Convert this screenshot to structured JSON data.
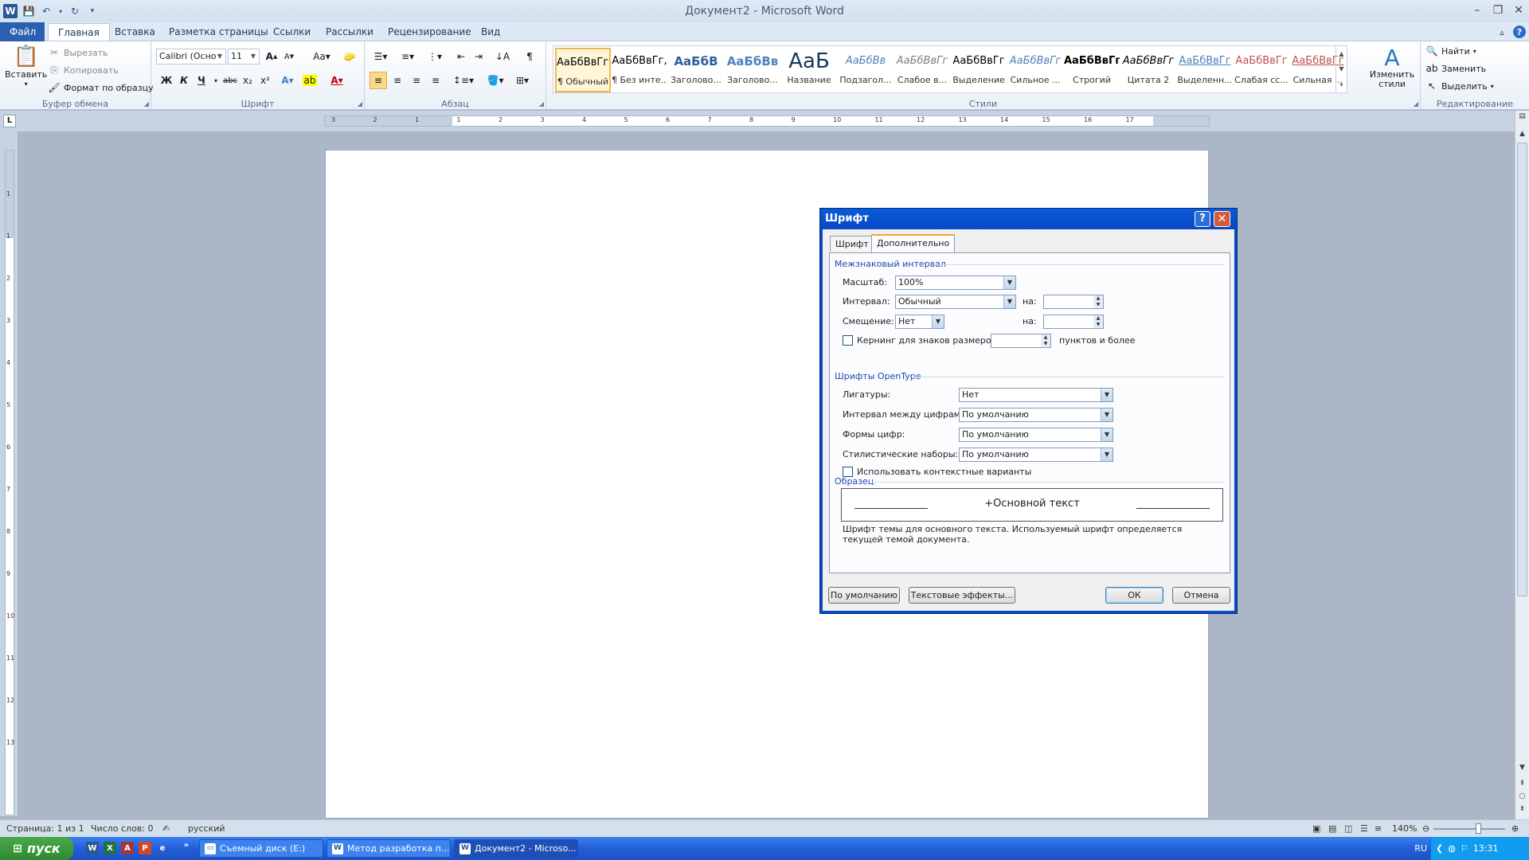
{
  "window": {
    "title": "Документ2  -  Microsoft Word",
    "minimize": "–",
    "maximize": "❐",
    "close": "✕"
  },
  "tabs": [
    "Файл",
    "Главная",
    "Вставка",
    "Разметка страницы",
    "Ссылки",
    "Рассылки",
    "Рецензирование",
    "Вид"
  ],
  "active_tab": "Главная",
  "ribbon": {
    "clipboard": {
      "label": "Буфер обмена",
      "paste": "Вставить",
      "cut": "Вырезать",
      "copy": "Копировать",
      "format_painter": "Формат по образцу"
    },
    "font": {
      "label": "Шрифт",
      "font_name": "Calibri (Осно",
      "font_size": "11"
    },
    "paragraph": {
      "label": "Абзац"
    },
    "styles": {
      "label": "Стили",
      "change_styles": "Изменить стили",
      "items": [
        {
          "sample": "АаБбВвГг,",
          "name": "¶ Обычный",
          "color": "#000000"
        },
        {
          "sample": "АаБбВвГг,",
          "name": "¶ Без инте...",
          "color": "#000000"
        },
        {
          "sample": "АаБбВ",
          "name": "Заголово...",
          "color": "#2e5c9c"
        },
        {
          "sample": "АаБбВв",
          "name": "Заголово...",
          "color": "#4f81bd"
        },
        {
          "sample": "АаБ",
          "name": "Название",
          "color": "#17365d"
        },
        {
          "sample": "АаБбВв",
          "name": "Подзагол...",
          "color": "#4f81bd"
        },
        {
          "sample": "АаБбВвГг",
          "name": "Слабое в...",
          "color": "#808080"
        },
        {
          "sample": "АаБбВвГг",
          "name": "Выделение",
          "color": "#000000"
        },
        {
          "sample": "АаБбВвГг",
          "name": "Сильное ...",
          "color": "#4f81bd"
        },
        {
          "sample": "АаБбВвГг,",
          "name": "Строгий",
          "color": "#000000"
        },
        {
          "sample": "АаБбВвГг",
          "name": "Цитата 2",
          "color": "#000000"
        },
        {
          "sample": "АаБбВвГг",
          "name": "Выделенн...",
          "color": "#4f81bd"
        },
        {
          "sample": "АаБбВвГг",
          "name": "Слабая сс...",
          "color": "#c0504d"
        },
        {
          "sample": "АаБбВвГг",
          "name": "Сильная ...",
          "color": "#c0504d"
        }
      ]
    },
    "editing": {
      "label": "Редактирование",
      "find": "Найти",
      "replace": "Заменить",
      "select": "Выделить"
    }
  },
  "ruler": {
    "ticks": [
      "3",
      "2",
      "1",
      "1",
      "2",
      "3",
      "4",
      "5",
      "6",
      "7",
      "8",
      "9",
      "10",
      "11",
      "12",
      "13",
      "14",
      "15",
      "16",
      "17"
    ],
    "v_ticks": [
      "1",
      "1",
      "2",
      "3",
      "4",
      "5",
      "6",
      "7",
      "8",
      "9",
      "10",
      "11",
      "12",
      "13"
    ]
  },
  "dialog": {
    "title": "Шрифт",
    "tabs": [
      "Шрифт",
      "Дополнительно"
    ],
    "active_tab": "Дополнительно",
    "spacing_section": "Межзнаковый интервал",
    "scale_label": "Масштаб:",
    "scale_value": "100%",
    "spacing_label": "Интервал:",
    "spacing_value": "Обычный",
    "by_label": "на:",
    "position_label": "Смещение:",
    "position_value": "Нет",
    "by2_label": "на:",
    "kerning_label": "Кернинг для знаков размером:",
    "kerning_checked": false,
    "points_label": "пунктов и более",
    "opentype_section": "Шрифты OpenType",
    "ligatures_label": "Лигатуры:",
    "ligatures_value": "Нет",
    "num_spacing_label": "Интервал между цифрами:",
    "num_spacing_value": "По умолчанию",
    "num_forms_label": "Формы цифр:",
    "num_forms_value": "По умолчанию",
    "stylistic_label": "Стилистические наборы:",
    "stylistic_value": "По умолчанию",
    "contextual_label": "Использовать контекстные варианты",
    "contextual_checked": false,
    "preview_section": "Образец",
    "preview_text": "+Основной текст",
    "description": "Шрифт темы для основного текста. Используемый шрифт определяется текущей темой документа.",
    "buttons": {
      "default": "По умолчанию",
      "text_effects": "Текстовые эффекты...",
      "ok": "ОК",
      "cancel": "Отмена"
    }
  },
  "statusbar": {
    "page": "Страница: 1 из 1",
    "words": "Число слов: 0",
    "language": "русский",
    "zoom": "140%",
    "zoom_level_percent": 140
  },
  "taskbar": {
    "start": "пуск",
    "tasks": [
      {
        "label": "Съемный диск (E:)",
        "active": false
      },
      {
        "label": "Метод разработка п...",
        "active": false
      },
      {
        "label": "Документ2 - Microso...",
        "active": true
      }
    ],
    "lang": "RU",
    "time": "13:31"
  },
  "colors": {
    "accent": "#2b5fb0",
    "dialog_frame": "#0a4ac8",
    "taskbar": "#235ed7",
    "start": "#3a9a3a"
  }
}
